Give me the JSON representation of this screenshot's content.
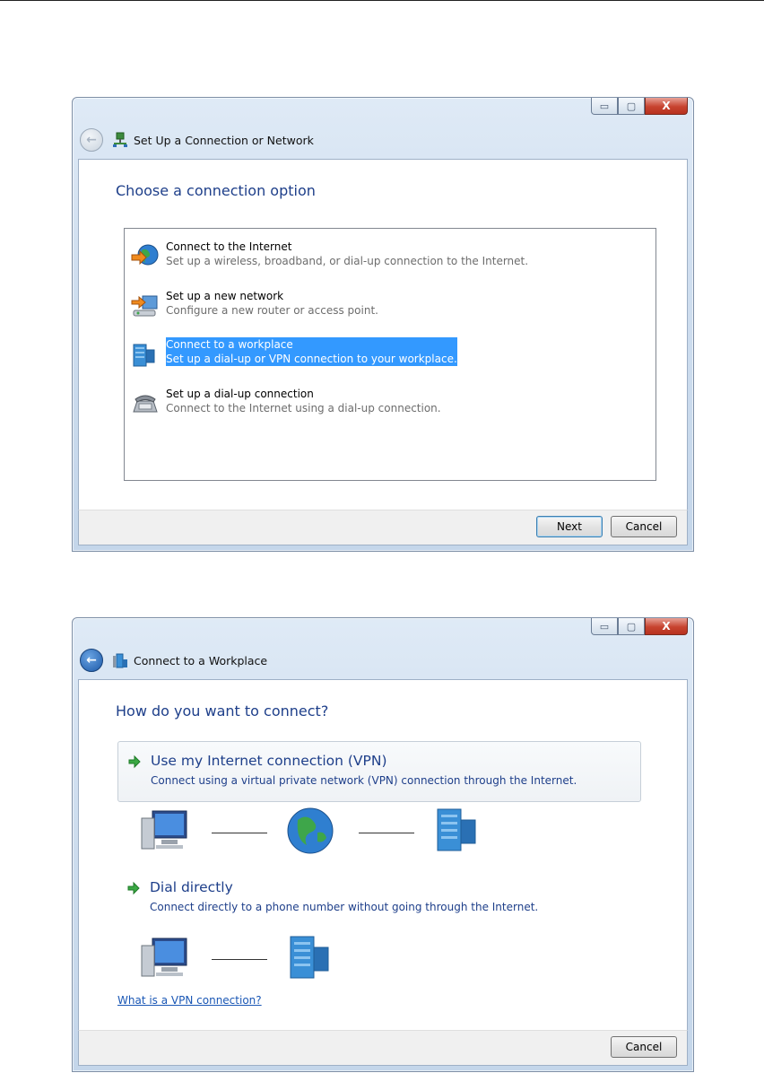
{
  "dialog1": {
    "title": "Set Up a Connection or Network",
    "heading": "Choose a connection option",
    "options": [
      {
        "title": "Connect to the Internet",
        "desc": "Set up a wireless, broadband, or dial-up connection to the Internet."
      },
      {
        "title": "Set up a new network",
        "desc": "Configure a new router or access point."
      },
      {
        "title": "Connect to a workplace",
        "desc": "Set up a dial-up or VPN connection to your workplace."
      },
      {
        "title": "Set up a dial-up connection",
        "desc": "Connect to the Internet using a dial-up connection."
      }
    ],
    "selected_index": 2,
    "next_label": "Next",
    "cancel_label": "Cancel"
  },
  "dialog2": {
    "title": "Connect to a Workplace",
    "heading": "How do you want to connect?",
    "vpn_title": "Use my Internet connection (VPN)",
    "vpn_desc": "Connect using a virtual private network (VPN) connection through the Internet.",
    "dial_title": "Dial directly",
    "dial_desc": "Connect directly to a phone number without going through the Internet.",
    "help_link": "What is a VPN connection?",
    "cancel_label": "Cancel"
  },
  "caption": {
    "minimize_glyph": "▭",
    "maximize_glyph": "▢",
    "close_glyph": "X"
  },
  "colors": {
    "heading": "#1e3f8a",
    "selection": "#3399ff",
    "link": "#1a57b5"
  },
  "icons": [
    "back-arrow-icon",
    "network-icon",
    "globe-icon",
    "router-icon",
    "workplace-building-icon",
    "dialup-phone-icon",
    "green-arrow-icon",
    "computer-icon"
  ]
}
